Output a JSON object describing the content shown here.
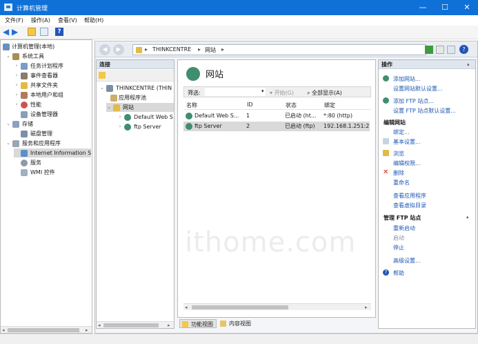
{
  "window": {
    "title": "计算机管理",
    "minimize": "—",
    "maximize": "☐",
    "close": "✕"
  },
  "menu": [
    "文件(F)",
    "操作(A)",
    "查看(V)",
    "帮助(H)"
  ],
  "tree": {
    "root": "计算机管理(本地)",
    "system_tools": "系统工具",
    "items_sys": [
      "任务计划程序",
      "事件查看器",
      "共享文件夹",
      "本地用户和组",
      "性能",
      "设备管理器"
    ],
    "storage": "存储",
    "disk_mgmt": "磁盘管理",
    "services_apps": "服务和应用程序",
    "items_apps": [
      "Internet Information S",
      "服务",
      "WMI 控件"
    ]
  },
  "address": {
    "seg1": "THINKCENTRE",
    "seg2": "网站",
    "sep": "▸"
  },
  "conn": {
    "header": "连接",
    "server": "THINKCENTRE (THIN",
    "app_pools": "应用程序池",
    "sites": "网站",
    "site1": "Default Web S",
    "site2": "ftp Server"
  },
  "center": {
    "title": "网站",
    "filter_label": "筛选:",
    "start_btn": "开始(G)",
    "show_all_btn": "全部显示(A)",
    "columns": [
      "名称",
      "ID",
      "状态",
      "绑定"
    ],
    "rows": [
      {
        "name": "Default Web S...",
        "id": "1",
        "status": "已启动 (ht...",
        "binding": "*:80 (http)"
      },
      {
        "name": "ftp Server",
        "id": "2",
        "status": "已启动 (ftp)",
        "binding": "192.168.1.251:21"
      }
    ],
    "features_view": "功能视图",
    "content_view": "内容视图"
  },
  "actions": {
    "header": "操作",
    "add_site": "添加网站...",
    "set_site_defaults": "设置网站默认设置...",
    "add_ftp": "添加 FTP 站点...",
    "set_ftp_defaults": "设置 FTP 站点默认设置...",
    "edit_site": "编辑网站",
    "bindings": "绑定...",
    "basic_settings": "基本设置...",
    "browse": "浏览",
    "edit_permissions": "编辑权限...",
    "delete": "删除",
    "rename": "重命名",
    "view_apps": "查看应用程序",
    "view_vdirs": "查看虚拟目录",
    "manage_ftp": "管理 FTP 站点",
    "restart": "重新启动",
    "start": "启动",
    "stop": "停止",
    "advanced": "高级设置...",
    "help": "帮助"
  },
  "watermark": "ithome.com",
  "colors": {
    "titlebar": "#0f70d8",
    "link": "#1c57b5",
    "selection": "#cce4f7",
    "header": "#dfe6ee"
  }
}
